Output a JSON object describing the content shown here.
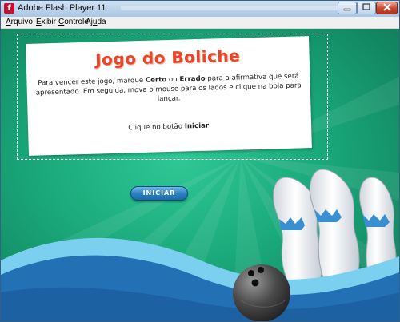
{
  "window": {
    "title": "Adobe Flash Player 11",
    "app_icon_glyph": "f"
  },
  "menu": {
    "items": [
      {
        "prefix": "",
        "accel": "A",
        "rest": "rquivo"
      },
      {
        "prefix": "",
        "accel": "E",
        "rest": "xibir"
      },
      {
        "prefix": "",
        "accel": "C",
        "rest": "ontrole"
      },
      {
        "prefix": "Aj",
        "accel": "u",
        "rest": "da"
      }
    ]
  },
  "game": {
    "title": "Jogo do Boliche",
    "instructions_1": "Para vencer este jogo, marque ",
    "certo": "Certo",
    "ou": " ou ",
    "errado": "Errado",
    "instructions_2": " para a afirmativa que será apresentado. Em seguida, mova o mouse para os lados e clique na bola para lançar.",
    "click_prefix": "Clique no botão ",
    "click_button": "Iniciar",
    "click_suffix": ".",
    "start_label": "INICIAR"
  },
  "colors": {
    "stage_green": "#1aa97a",
    "title_red": "#e8452a",
    "button_blue": "#2c7ec0",
    "wave_blue": "#2470b5"
  }
}
